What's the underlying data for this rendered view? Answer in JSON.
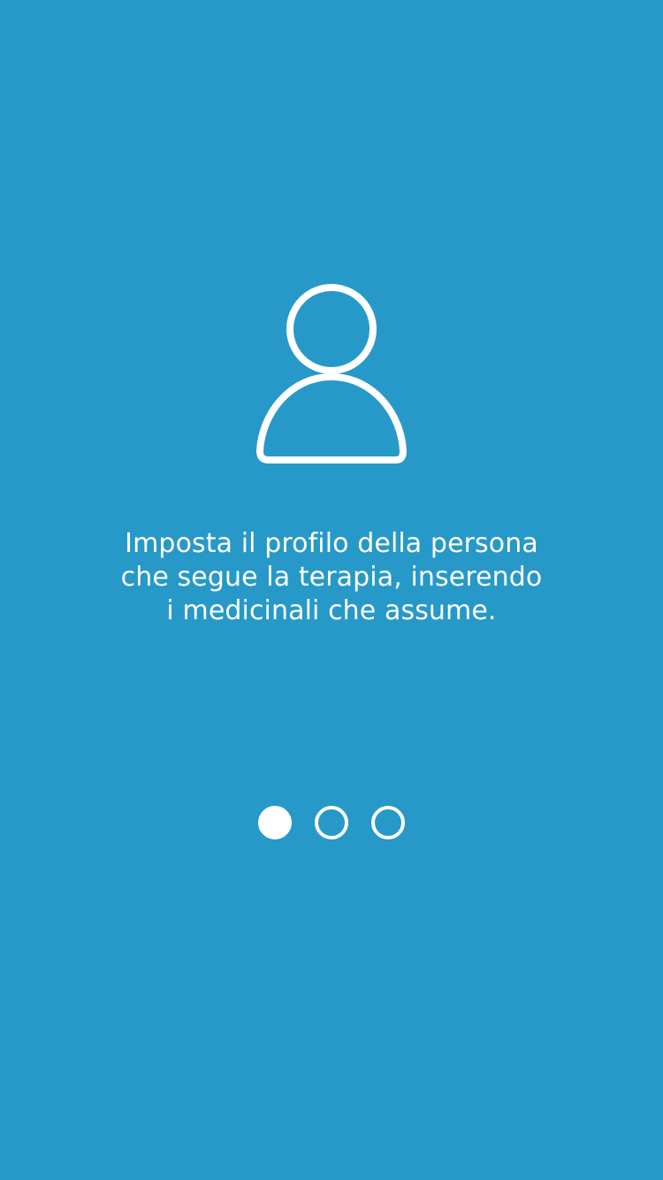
{
  "theme": {
    "background": "#2699c8",
    "foreground": "#ffffff"
  },
  "onboarding": {
    "icon": "user-profile-icon",
    "message_lines": [
      "Imposta il profilo della persona",
      "che segue la terapia, inserendo",
      "i medicinali che assume."
    ],
    "pager": {
      "total": 3,
      "current": 1
    }
  }
}
